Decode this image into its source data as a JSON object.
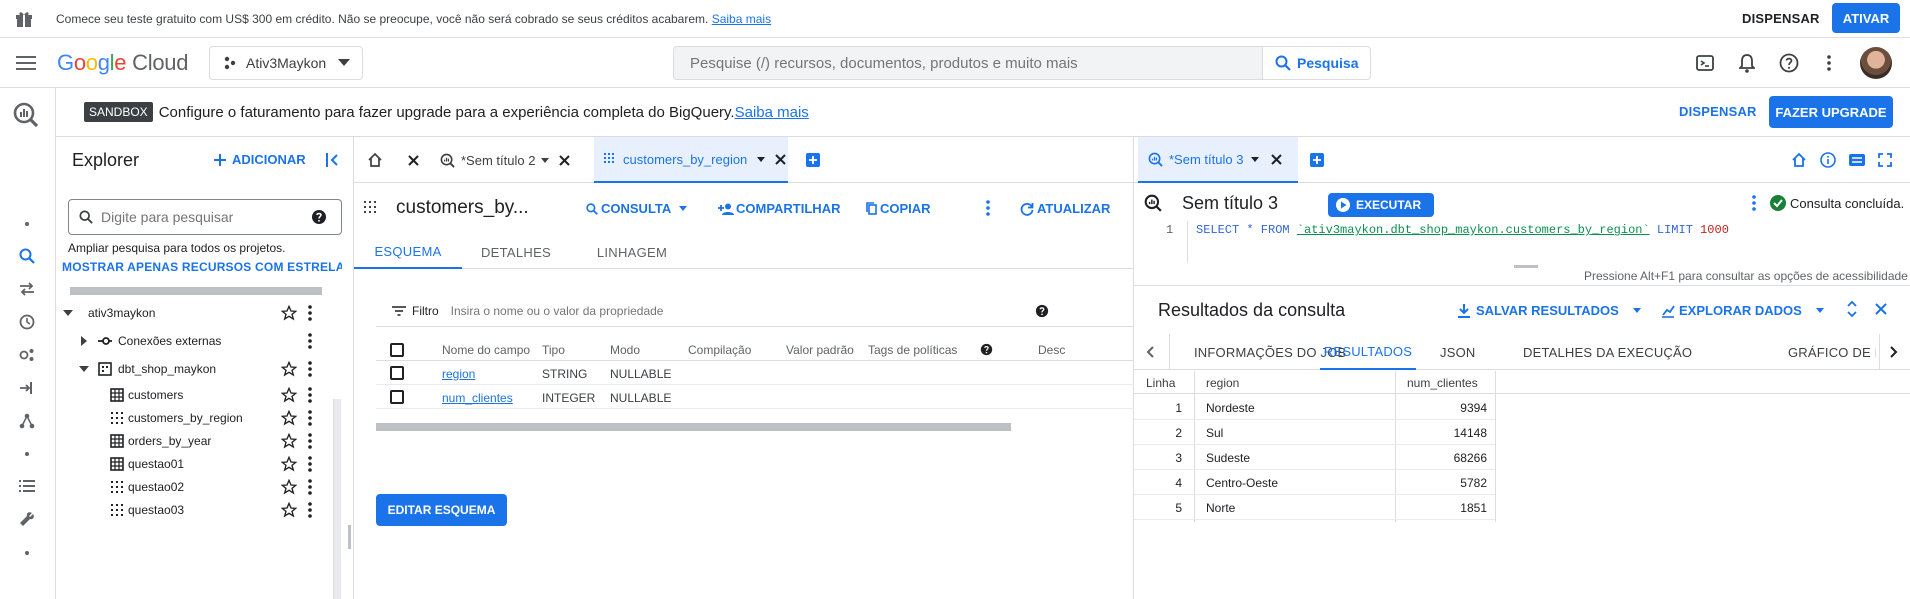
{
  "promo": {
    "text": "Comece seu teste gratuito com US$ 300 em crédito. Não se preocupe, você não será cobrado se seus créditos acabarem.",
    "link": "Saiba mais",
    "dismiss": "DISPENSAR",
    "activate": "ATIVAR"
  },
  "header": {
    "logo_google": [
      "G",
      "o",
      "o",
      "g",
      "l",
      "e"
    ],
    "logo_cloud": "Cloud",
    "project": "Ativ3Maykon",
    "search_placeholder": "Pesquise (/) recursos, documentos, produtos e muito mais",
    "search_button": "Pesquisa"
  },
  "sandbox": {
    "badge": "SANDBOX",
    "message": "Configure o faturamento para fazer upgrade para a experiência completa do BigQuery.",
    "link": "Saiba mais",
    "dismiss": "DISPENSAR",
    "upgrade": "FAZER UPGRADE"
  },
  "explorer": {
    "title": "Explorer",
    "add": "ADICIONAR",
    "search_placeholder": "Digite para pesquisar",
    "hint": "Ampliar pesquisa para todos os projetos.",
    "starred_link": "MOSTRAR APENAS RECURSOS COM ESTRELA",
    "project": "ativ3maykon",
    "external": "Conexões externas",
    "dataset": "dbt_shop_maykon",
    "tables": [
      {
        "name": "customers",
        "kind": "table"
      },
      {
        "name": "customers_by_region",
        "kind": "view"
      },
      {
        "name": "orders_by_year",
        "kind": "table"
      },
      {
        "name": "questao01",
        "kind": "table"
      },
      {
        "name": "questao02",
        "kind": "view"
      },
      {
        "name": "questao03",
        "kind": "view"
      }
    ]
  },
  "middle": {
    "tabs": [
      {
        "label": ""
      },
      {
        "label": "*Sem título 2"
      },
      {
        "label": "customers_by_region"
      }
    ],
    "title": "customers_by...",
    "actions": {
      "query": "CONSULTA",
      "share": "COMPARTILHAR",
      "copy": "COPIAR",
      "refresh": "ATUALIZAR"
    },
    "subtabs": [
      "ESQUEMA",
      "DETALHES",
      "LINHAGEM"
    ],
    "filter_label": "Filtro",
    "filter_placeholder": "Insira o nome ou o valor da propriedade",
    "columns": [
      "Nome do campo",
      "Tipo",
      "Modo",
      "Compilação",
      "Valor padrão",
      "Tags de políticas",
      "Desc"
    ],
    "fields": [
      {
        "name": "region",
        "type": "STRING",
        "mode": "NULLABLE"
      },
      {
        "name": "num_clientes",
        "type": "INTEGER",
        "mode": "NULLABLE"
      }
    ],
    "edit_schema": "EDITAR ESQUEMA"
  },
  "right": {
    "tab": "*Sem título 3",
    "editor_title": "Sem título 3",
    "run": "EXECUTAR",
    "status": "Consulta concluída.",
    "line_number": "1",
    "sql_keyword_1": "SELECT * FROM ",
    "sql_table": "`ativ3maykon.dbt_shop_maykon.customers_by_region`",
    "sql_keyword_2": " LIMIT ",
    "sql_limit": "1000",
    "a11y_hint": "Pressione Alt+F1 para consultar as opções de acessibilidade",
    "results_title": "Resultados da consulta",
    "save_results": "SALVAR RESULTADOS",
    "explore_data": "EXPLORAR DADOS",
    "result_tabs": [
      "INFORMAÇÕES DO JOB",
      "RESULTADOS",
      "JSON",
      "DETALHES DA EXECUÇÃO",
      "GRÁFICO DE EX"
    ],
    "grid_headers": [
      "Linha",
      "region",
      "num_clientes"
    ],
    "rows": [
      {
        "n": "1",
        "region": "Nordeste",
        "num": "9394"
      },
      {
        "n": "2",
        "region": "Sul",
        "num": "14148"
      },
      {
        "n": "3",
        "region": "Sudeste",
        "num": "68266"
      },
      {
        "n": "4",
        "region": "Centro-Oeste",
        "num": "5782"
      },
      {
        "n": "5",
        "region": "Norte",
        "num": "1851"
      }
    ]
  },
  "colors": {
    "accent": "#1a73e8",
    "success": "#188038",
    "sql_keyword": "#3367d6",
    "sql_string": "#0d904f",
    "sql_number": "#c5221f"
  }
}
